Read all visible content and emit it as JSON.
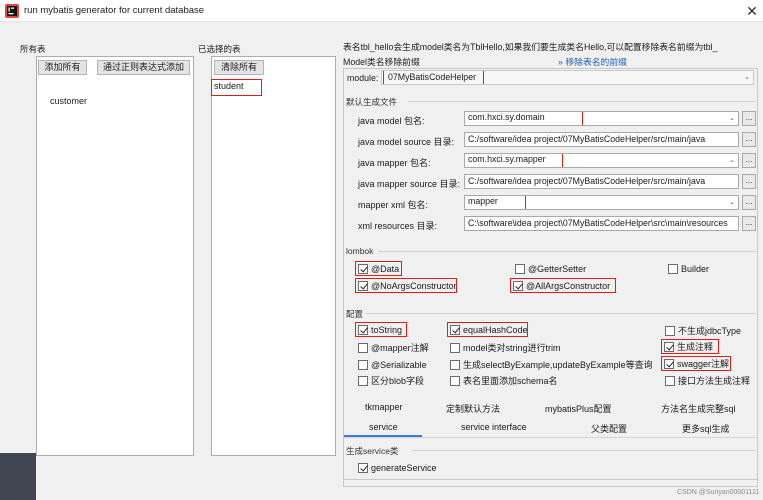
{
  "window": {
    "title": "run mybatis generator for current database"
  },
  "left": {
    "all_tables_label": "所有表",
    "btn_add_all": "添加所有",
    "btn_add_regex": "通过正则表达式添加",
    "tables": [
      "customer"
    ]
  },
  "middle": {
    "selected_label": "已选择的表",
    "btn_remove_all": "清除所有",
    "selected_tables": [
      "student"
    ]
  },
  "notice": {
    "line1": "表名tbl_hello会生成model类名为TblHello,如果我们要生成类名Hello,可以配置移除表名前缀为tbl_",
    "line2": "Model类名移除前缀",
    "link": "移除表名的前缀",
    "link_arrow": "»"
  },
  "module": {
    "label": "module:",
    "value": "07MyBatisCodeHelper"
  },
  "default_files": {
    "title": "默认生成文件",
    "rows": [
      {
        "label": "java model 包名:",
        "value": "com.hxci.sy.domain"
      },
      {
        "label": "java model source 目录:",
        "value": "C:/software/idea project/07MyBatisCodeHelper/src/main/java"
      },
      {
        "label": "java mapper 包名:",
        "value": "com.hxci.sy.mapper"
      },
      {
        "label": "java mapper source 目录:",
        "value": "C:/software/idea project/07MyBatisCodeHelper/src/main/java"
      },
      {
        "label": "mapper xml 包名:",
        "value": "mapper"
      },
      {
        "label": "xml resources 目录:",
        "value": "C:\\software\\idea project\\07MyBatisCodeHelper\\src\\main\\resources"
      }
    ],
    "browse": "..."
  },
  "lombok": {
    "title": "lombok",
    "items": [
      {
        "label": "@Data",
        "checked": true
      },
      {
        "label": "@GetterSetter",
        "checked": false
      },
      {
        "label": "Builder",
        "checked": false
      },
      {
        "label": "@NoArgsConstructor",
        "checked": true
      },
      {
        "label": "@AllArgsConstructor",
        "checked": true
      }
    ]
  },
  "config": {
    "title": "配置",
    "items": [
      {
        "label": "toString",
        "checked": true
      },
      {
        "label": "equalHashCode",
        "checked": true
      },
      {
        "label": "不生成jdbcType",
        "checked": false
      },
      {
        "label": "@mapper注解",
        "checked": false
      },
      {
        "label": "model类对string进行trim",
        "checked": false
      },
      {
        "label": "生成注释",
        "checked": true
      },
      {
        "label": "@Serializable",
        "checked": false
      },
      {
        "label": "生成selectByExample,updateByExample等查询",
        "checked": false
      },
      {
        "label": "swagger注解",
        "checked": true
      },
      {
        "label": "区分blob字段",
        "checked": false
      },
      {
        "label": "表名里面添加schema名",
        "checked": false
      },
      {
        "label": "接口方法生成注释",
        "checked": false
      }
    ]
  },
  "tabs_row1": [
    "tkmapper",
    "定制默认方法",
    "mybatisPlus配置",
    "方法名生成完整sql"
  ],
  "tabs_row2": [
    "service",
    "service interface",
    "父类配置",
    "更多sql生成"
  ],
  "service": {
    "title": "生成service类",
    "generate_label": "generateService",
    "generate_checked": true
  },
  "watermark": "CSDN @Sunyan00001111"
}
